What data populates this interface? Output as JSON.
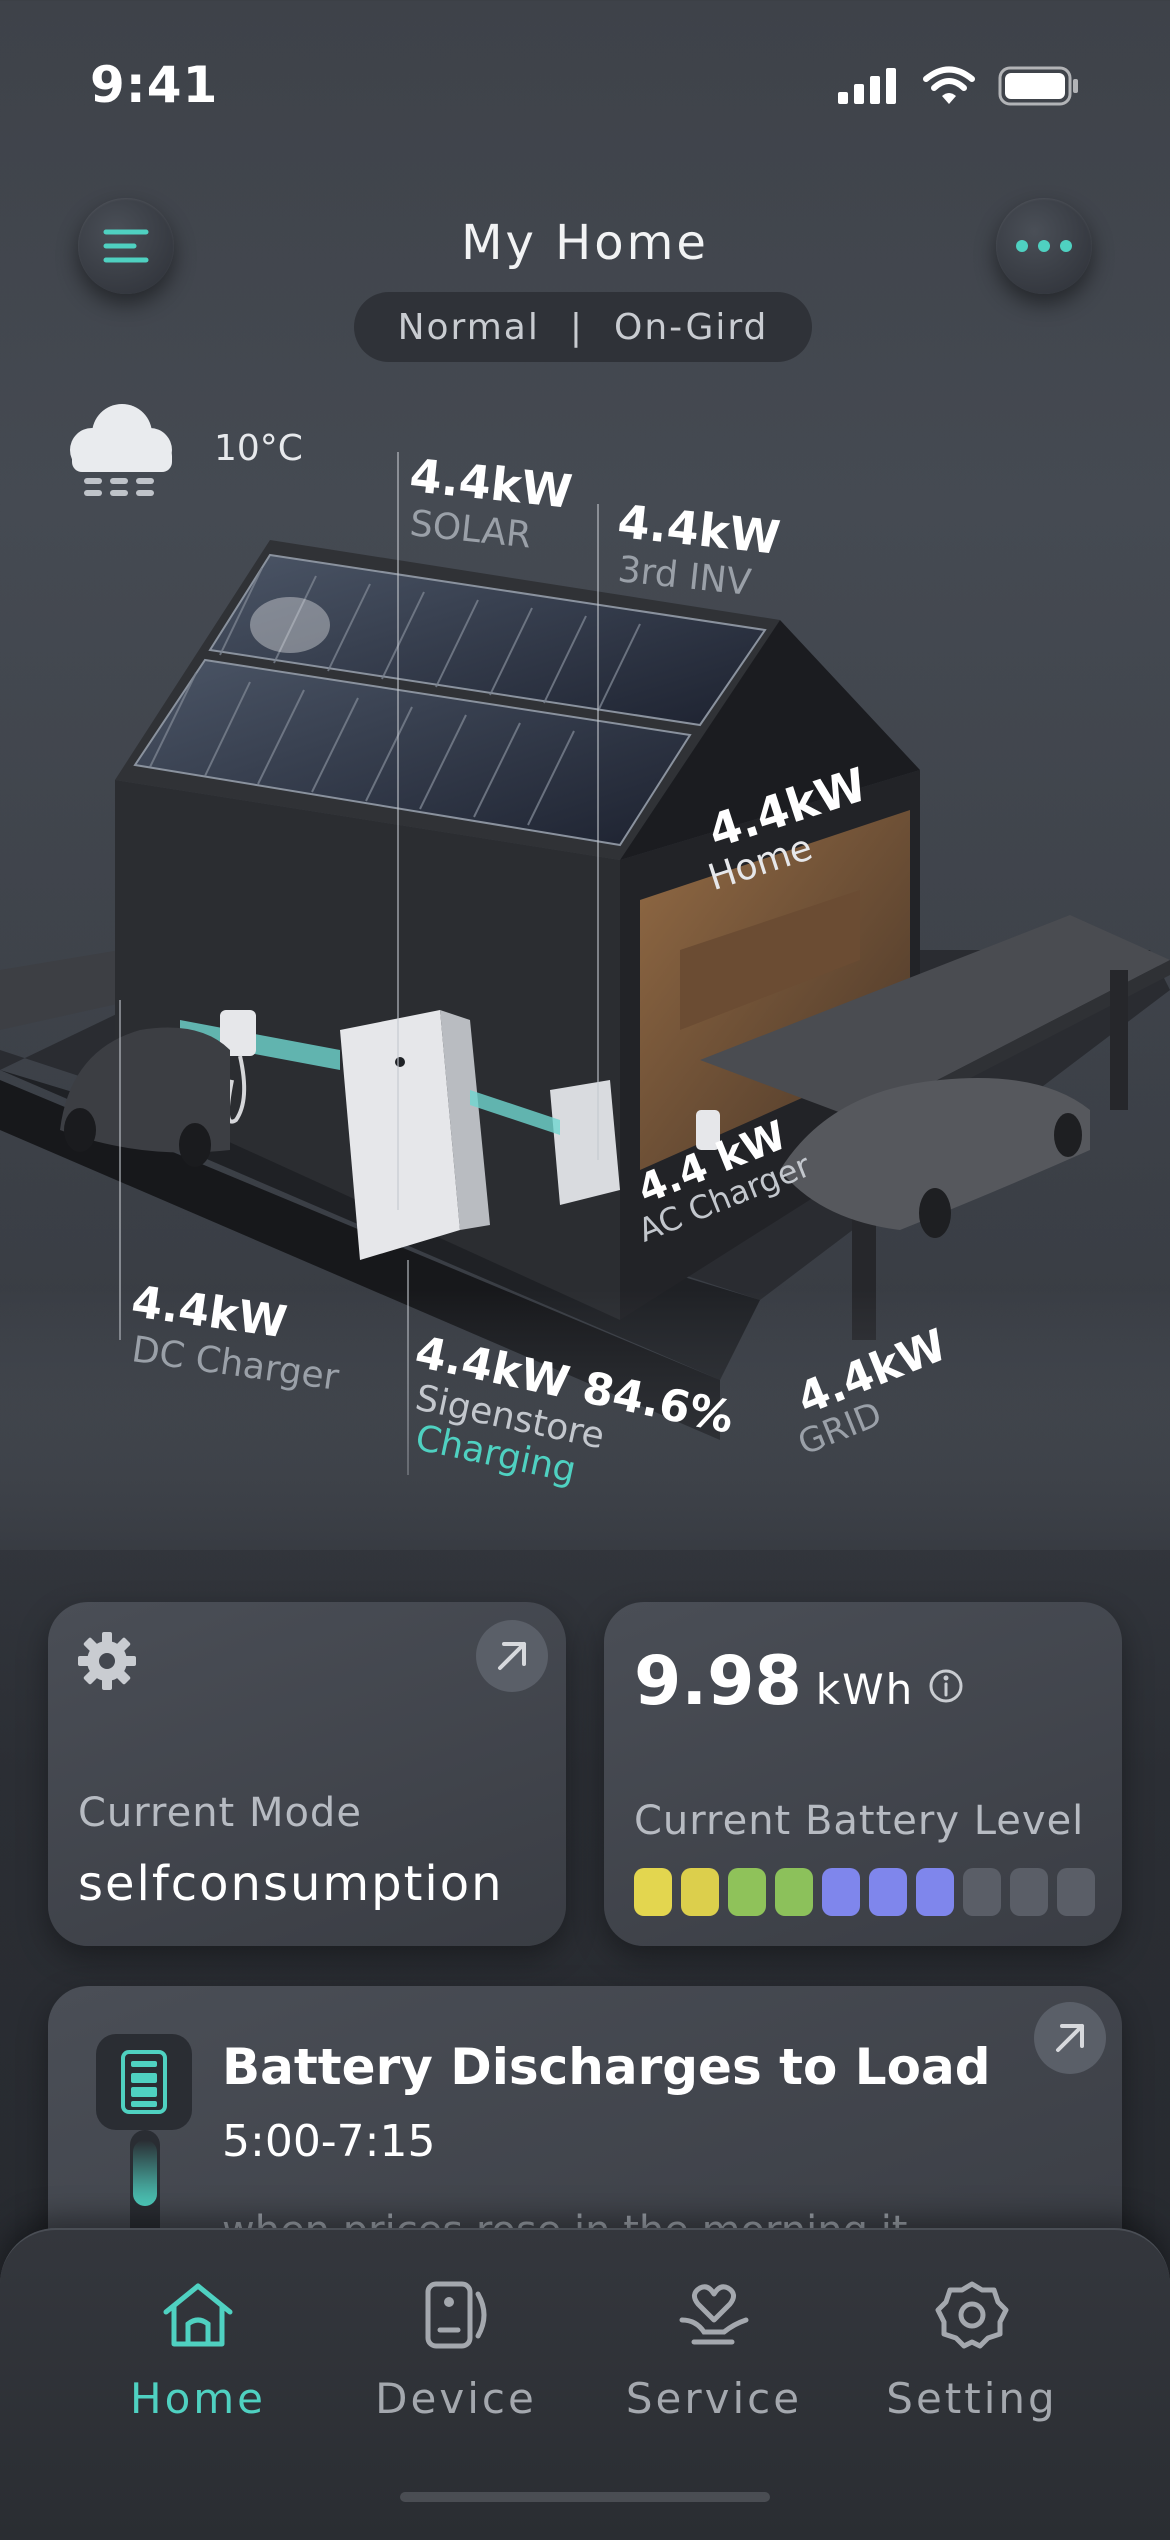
{
  "status_bar": {
    "time": "9:41"
  },
  "header": {
    "title": "My Home",
    "mode": "Normal",
    "separator": "|",
    "grid_status": "On-Gird"
  },
  "weather": {
    "icon": "cloud-fog-icon",
    "temperature": "10°C"
  },
  "energy": {
    "solar": {
      "value": "4.4kW",
      "label": "SOLAR"
    },
    "inverter": {
      "value": "4.4kW",
      "label": "3rd INV"
    },
    "home": {
      "value": "4.4kW",
      "label": "Home"
    },
    "ac_charger": {
      "value": "4.4 kW",
      "label": "AC Charger"
    },
    "dc_charger": {
      "value": "4.4kW",
      "label": "DC Charger"
    },
    "storage": {
      "value": "4.4kW 84.6%",
      "label": "Sigenstore",
      "status": "Charging"
    },
    "grid": {
      "value": "4.4kW",
      "label": "GRID"
    }
  },
  "mode_card": {
    "label": "Current Mode",
    "value": "selfconsumption"
  },
  "battery_card": {
    "value": "9.98",
    "unit": "kWh",
    "label": "Current Battery Level",
    "level_segments": [
      "#e3d64f",
      "#dccf4c",
      "#8fc25a",
      "#8cc15b",
      "#7f86ec",
      "#7f86ec",
      "#7f86ec",
      "#5a5e67",
      "#5a5e67",
      "#5a5e67"
    ]
  },
  "schedule_card": {
    "title": "Battery Discharges to Load",
    "time": "5:00-7:15",
    "description": "when prices rose in the morning it"
  },
  "nav": {
    "items": [
      {
        "label": "Home",
        "icon": "home-icon",
        "active": true
      },
      {
        "label": "Device",
        "icon": "device-icon",
        "active": false
      },
      {
        "label": "Service",
        "icon": "service-icon",
        "active": false
      },
      {
        "label": "Setting",
        "icon": "setting-icon",
        "active": false
      }
    ]
  },
  "colors": {
    "accent": "#4fd1c1",
    "text_dim": "#9aa0a8",
    "card": "#43474f"
  }
}
